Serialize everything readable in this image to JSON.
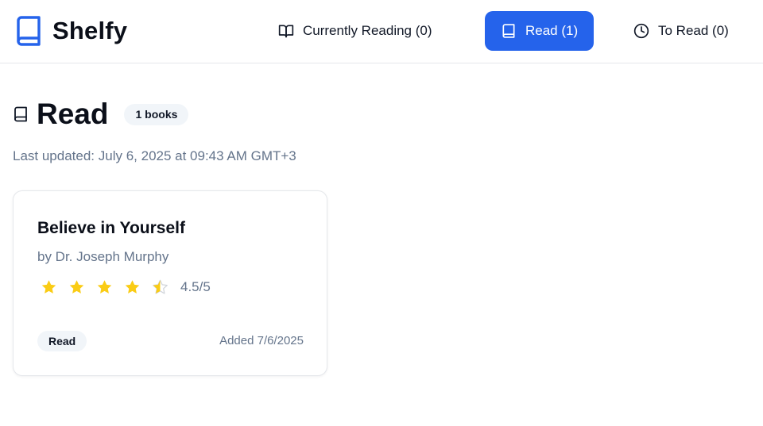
{
  "brand": {
    "name": "Shelfy",
    "icon": "book-icon",
    "color": "#2563eb"
  },
  "nav": {
    "items": [
      {
        "label": "Currently Reading (0)",
        "icon": "book-open-icon",
        "active": false
      },
      {
        "label": "Read (1)",
        "icon": "book-icon",
        "active": true
      },
      {
        "label": "To Read (0)",
        "icon": "clock-icon",
        "active": false
      }
    ],
    "active_color": "#2563eb"
  },
  "page": {
    "title": "Read",
    "icon": "book-icon",
    "count_badge": "1 books",
    "last_updated": "Last updated: July 6, 2025 at 09:43 AM GMT+3"
  },
  "books": [
    {
      "title": "Believe in Yourself",
      "author": "by Dr. Joseph Murphy",
      "rating": 4.5,
      "rating_text": "4.5/5",
      "status": "Read",
      "added": "Added 7/6/2025"
    }
  ],
  "colors": {
    "star": "#facc15",
    "star_empty": "#d1d5db",
    "muted_text": "#64748b",
    "badge_bg": "#f1f5f9"
  }
}
